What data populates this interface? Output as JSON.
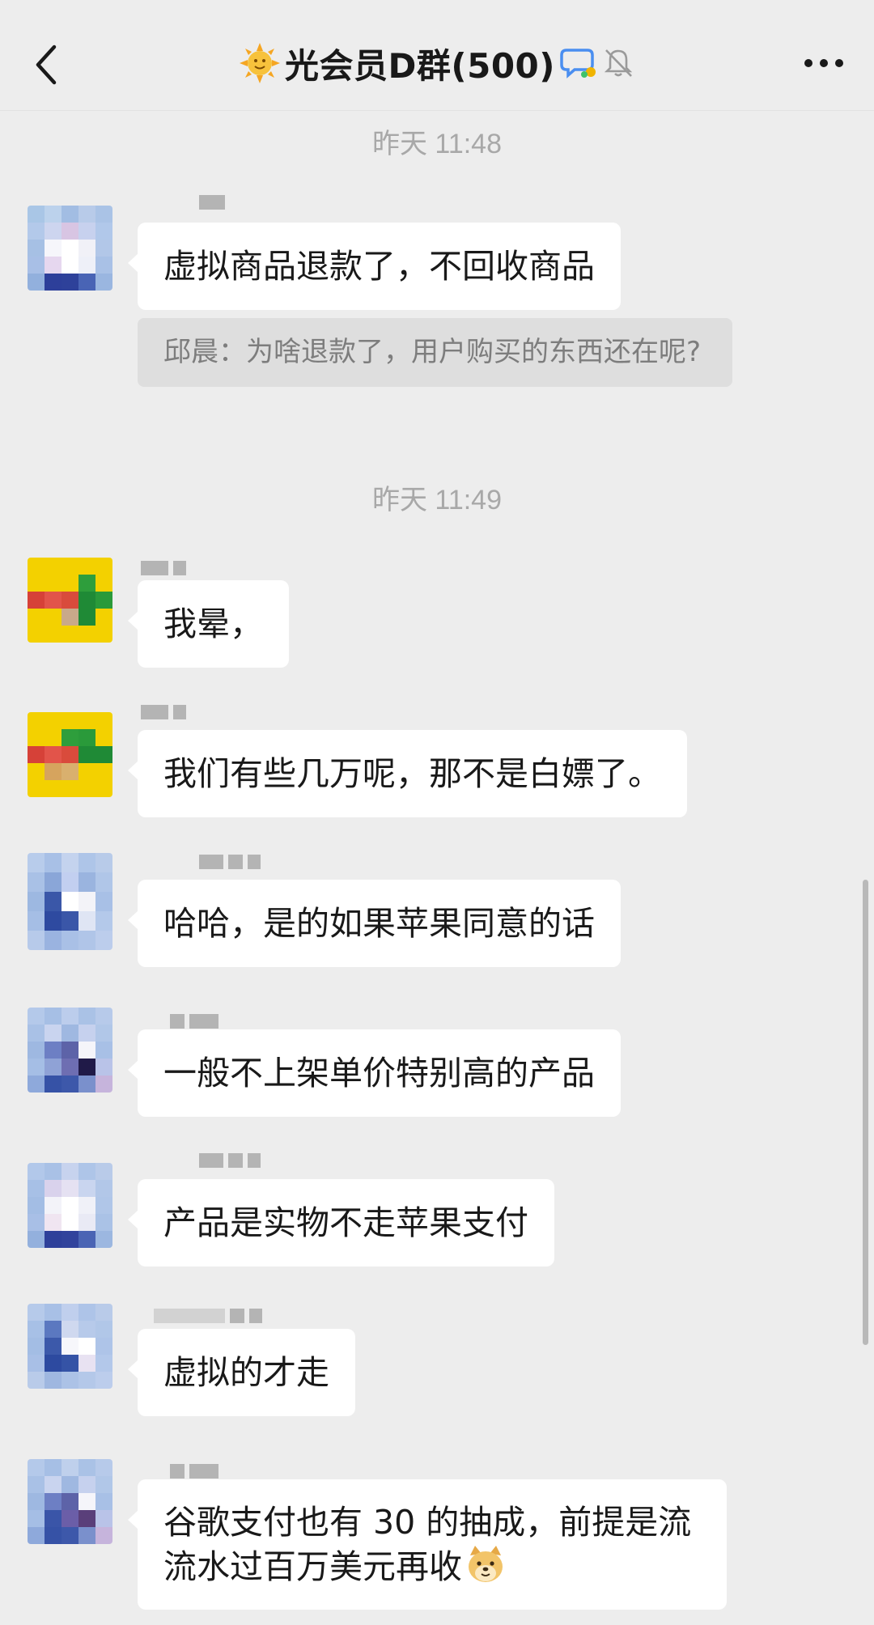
{
  "header": {
    "title": "光会员D群(500)",
    "icons": [
      "back-chevron-icon",
      "sun-emoji-icon",
      "chat-bubble-icon",
      "mute-bell-icon",
      "more-dots-icon"
    ]
  },
  "messages": {
    "timestamp_1": "昨天 11:48",
    "m1": "虚拟商品退款了，不回收商品",
    "m1_quote": "邱晨：为啥退款了，用户购买的东西还在呢?",
    "timestamp_2": "昨天 11:49",
    "m2": "我晕，",
    "m3": "我们有些几万呢，那不是白嫖了。",
    "m4": "哈哈，是的如果苹果同意的话",
    "m5": "一般不上架单价特别高的产品",
    "m6": "产品是实物不走苹果支付",
    "m7": "虚拟的才走",
    "m8": "谷歌支付也有 30 的抽成，前提是流流水过百万美元再收"
  },
  "colors": {
    "background": "#ededed",
    "bubble": "#ffffff",
    "quote_bg": "#dedede",
    "timestamp": "#a8a8a8"
  }
}
